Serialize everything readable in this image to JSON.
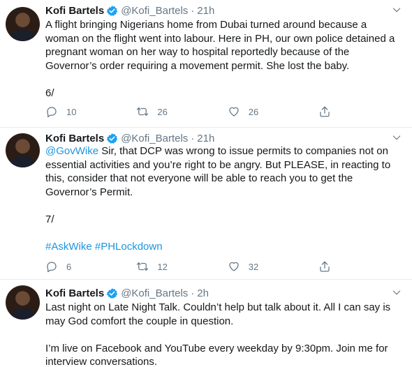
{
  "colors": {
    "link": "#1b95e0",
    "muted": "#657786",
    "text": "#14171a",
    "verified": "#1da1f2"
  },
  "tweets": [
    {
      "name": "Kofi Bartels",
      "handle": "@Kofi_Bartels",
      "separator": "·",
      "time": "21h",
      "lines": [
        "A flight bringing Nigerians home from Dubai turned around because a",
        "woman on the flight went into labour. Here in PH, our own police detained a",
        "pregnant woman on her way to hospital reportedly because of the",
        "Governor’s order requiring a movement permit. She lost the baby."
      ],
      "footer": "6/",
      "replies": "10",
      "retweets": "26",
      "likes": "26"
    },
    {
      "name": "Kofi Bartels",
      "handle": "@Kofi_Bartels",
      "separator": "·",
      "time": "21h",
      "mention": "@GovWike",
      "line1_rest": " Sir, that DCP was wrong to issue permits to companies not on",
      "lines": [
        "essential activities and you’re right to be angry. But PLEASE, in reacting to",
        "this, consider that not everyone will be able to reach you to get the",
        "Governor’s Permit."
      ],
      "footer": "7/",
      "hashtags": "#AskWike #PHLockdown",
      "replies": "6",
      "retweets": "12",
      "likes": "32"
    },
    {
      "name": "Kofi Bartels",
      "handle": "@Kofi_Bartels",
      "separator": "·",
      "time": "2h",
      "lines": [
        "Last night on Late Night Talk. Couldn’t help but talk about it. All I can say is",
        "may God comfort the couple in question."
      ],
      "lines2": [
        "I’m live on Facebook and YouTube every weekday by 9:30pm. Join me for",
        "interview conversations."
      ]
    }
  ]
}
